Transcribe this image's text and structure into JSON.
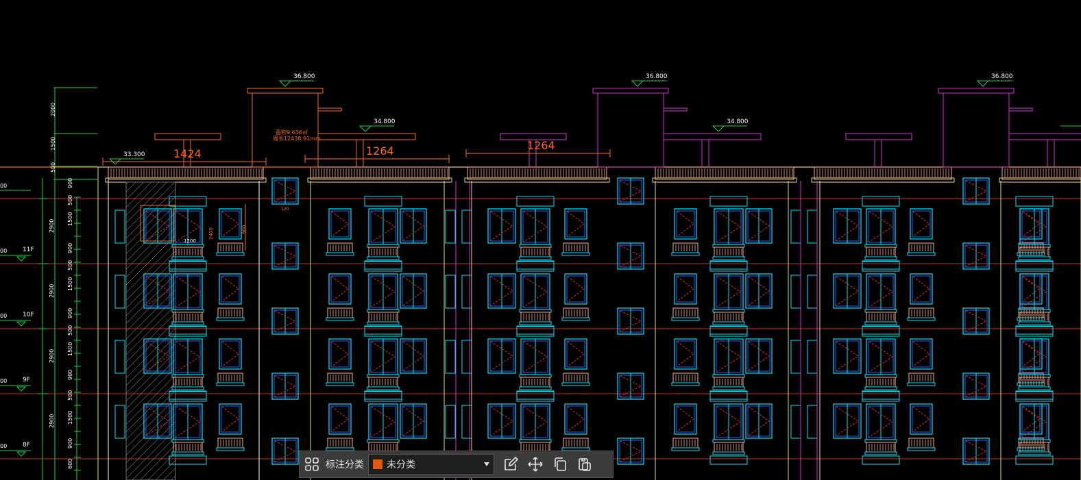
{
  "drawing": {
    "elevations": [
      {
        "text": "36.800"
      },
      {
        "text": "36.800"
      },
      {
        "text": "36.800"
      },
      {
        "text": "34.800"
      },
      {
        "text": "34.800"
      },
      {
        "text": "33.300"
      }
    ],
    "dims_orange": [
      "1424",
      "1264",
      "1264"
    ],
    "area_note": [
      "面积9.636㎡",
      "周长12438.91mm"
    ],
    "side_dims": [
      "2000",
      "1500",
      "500",
      "900",
      "500",
      "1500",
      "900",
      "500",
      "1500",
      "900",
      "500",
      "1500",
      "900",
      "500",
      "1500",
      "900",
      "600"
    ],
    "floor_vals": [
      "2900",
      "2900",
      "2900",
      "2900"
    ],
    "floor_labels": [
      "11F",
      "10F",
      "9F",
      "8F"
    ],
    "left_values": [
      "00",
      "00",
      "00",
      "00",
      "00",
      "00"
    ],
    "window_dims": [
      "1200",
      "2400",
      "900",
      "120"
    ]
  },
  "toolbar": {
    "category_label": "标注分类",
    "category_value": "未分类",
    "category_color": "#e05a12"
  },
  "icons": [
    "grid-icon",
    "edit-icon",
    "move-icon",
    "copy-icon",
    "paste-icon"
  ]
}
